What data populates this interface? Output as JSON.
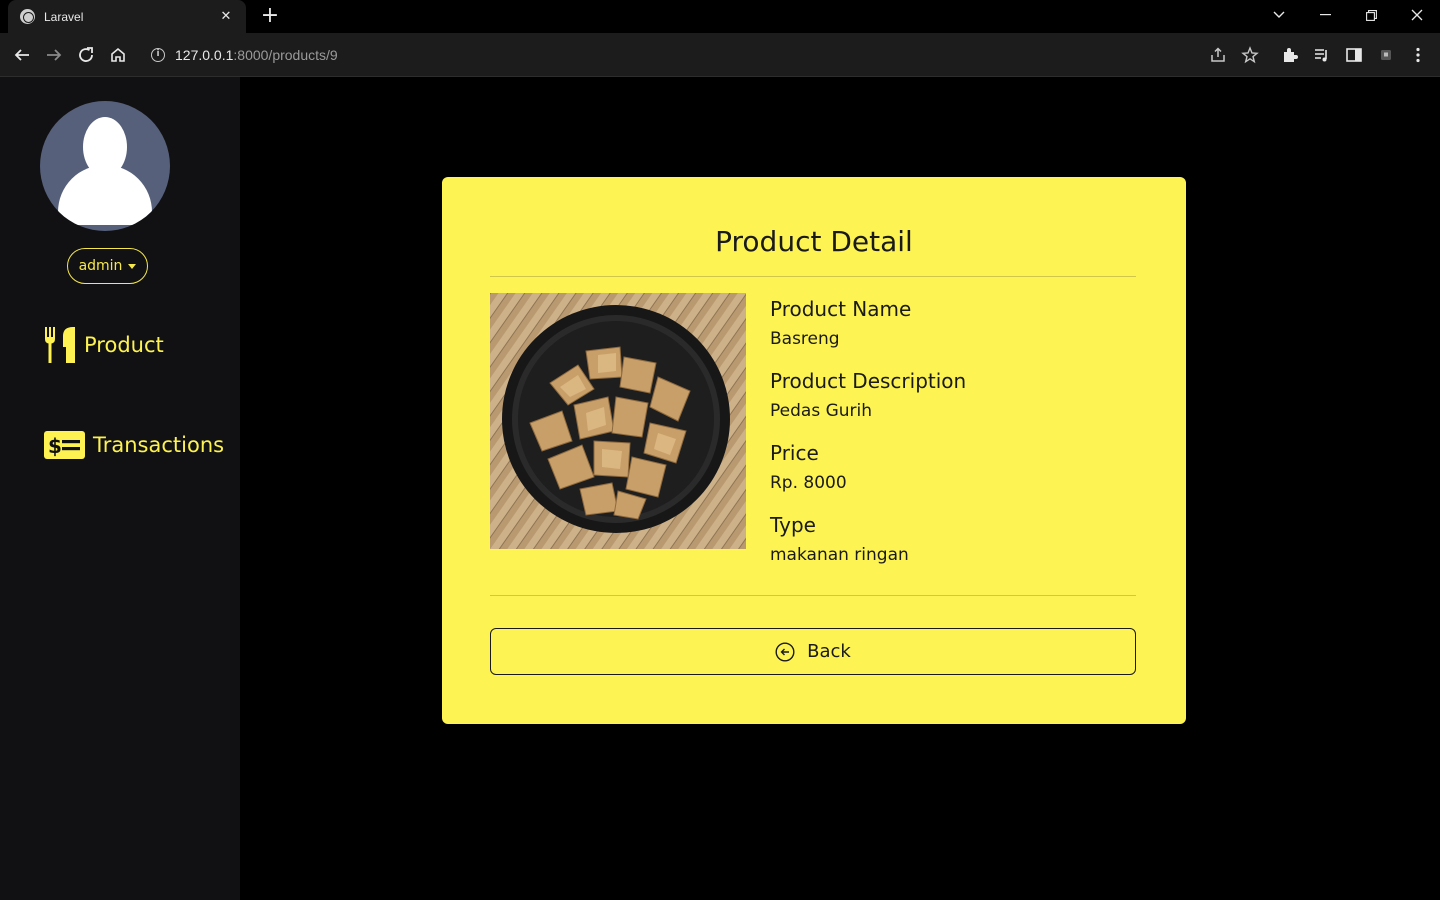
{
  "browser": {
    "tab_title": "Laravel",
    "url_host": "127.0.0.1",
    "url_path": ":8000/products/9"
  },
  "sidebar": {
    "user_menu_label": "admin",
    "items": [
      {
        "label": "Product",
        "icon": "utensils-icon"
      },
      {
        "label": "Transactions",
        "icon": "money-bill-icon"
      }
    ]
  },
  "card": {
    "title": "Product Detail",
    "image": "basreng-chips-plate",
    "fields": [
      {
        "label": "Product Name",
        "value": "Basreng"
      },
      {
        "label": "Product Description",
        "value": "Pedas Gurih"
      },
      {
        "label": "Price",
        "value": "Rp. 8000"
      },
      {
        "label": "Type",
        "value": "makanan ringan"
      }
    ],
    "back_label": "Back"
  },
  "colors": {
    "accent": "#fdf454",
    "sidebar_bg": "#111114",
    "page_bg": "#000000"
  }
}
